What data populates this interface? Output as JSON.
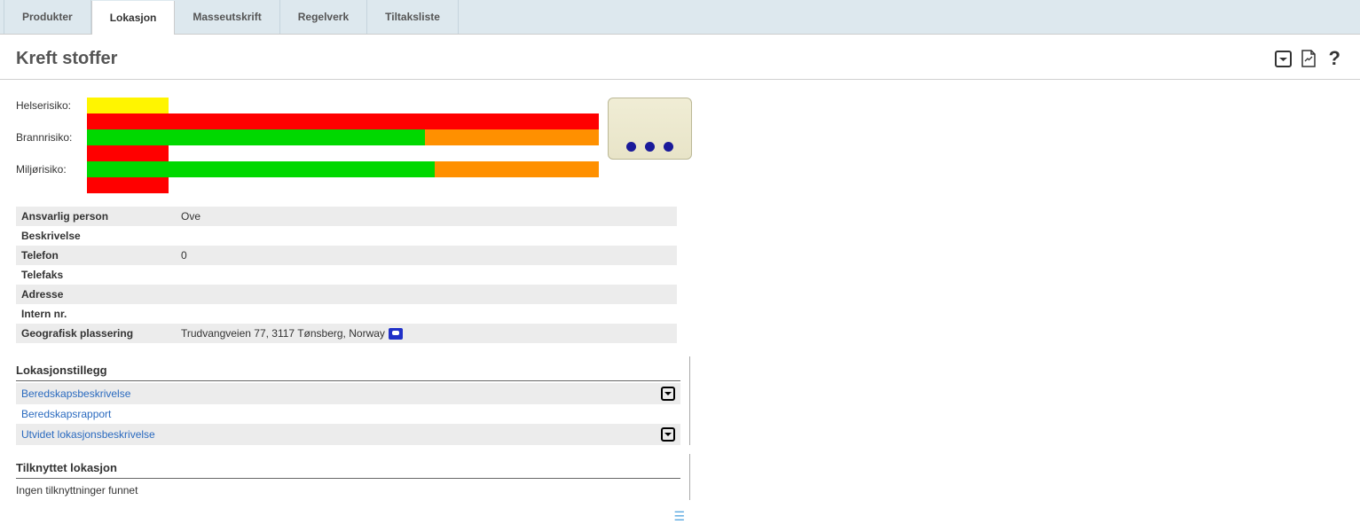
{
  "tabs": {
    "items": [
      {
        "label": "Produkter",
        "active": false
      },
      {
        "label": "Lokasjon",
        "active": true
      },
      {
        "label": "Masseutskrift",
        "active": false
      },
      {
        "label": "Regelverk",
        "active": false
      },
      {
        "label": "Tiltaksliste",
        "active": false
      }
    ]
  },
  "page_title": "Kreft stoffer",
  "risk": {
    "rows": [
      {
        "label": "Helserisiko:"
      },
      {
        "label": "Brannrisiko:"
      },
      {
        "label": "Miljørisiko:"
      }
    ]
  },
  "chart_data": {
    "type": "bar",
    "title": "",
    "xlabel": "",
    "ylabel": "",
    "categories": [
      "Helserisiko",
      "Brannrisiko",
      "Miljørisiko"
    ],
    "series": [
      {
        "name": "row1",
        "segments_pct": [
          [
            16,
            "yellow"
          ]
        ]
      },
      {
        "name": "row2",
        "segments_pct": [
          [
            100,
            "red"
          ]
        ]
      },
      {
        "name": "row3",
        "segments_pct": [
          [
            66,
            "green"
          ],
          [
            34,
            "orange"
          ]
        ]
      },
      {
        "name": "row4",
        "segments_pct": [
          [
            16,
            "red"
          ]
        ]
      },
      {
        "name": "row5",
        "segments_pct": [
          [
            68,
            "green"
          ],
          [
            32,
            "orange"
          ]
        ]
      },
      {
        "name": "row6",
        "segments_pct": [
          [
            16,
            "red"
          ]
        ]
      }
    ]
  },
  "info": {
    "rows": [
      {
        "label": "Ansvarlig person",
        "value": "Ove"
      },
      {
        "label": "Beskrivelse",
        "value": ""
      },
      {
        "label": "Telefon",
        "value": "0"
      },
      {
        "label": "Telefaks",
        "value": ""
      },
      {
        "label": "Adresse",
        "value": ""
      },
      {
        "label": "Intern nr.",
        "value": ""
      },
      {
        "label": "Geografisk plassering",
        "value": "Trudvangveien 77, 3117 Tønsberg, Norway",
        "map": true
      }
    ]
  },
  "addons": {
    "title": "Lokasjonstillegg",
    "items": [
      {
        "label": "Beredskapsbeskrivelse",
        "icon": true
      },
      {
        "label": "Beredskapsrapport",
        "icon": false
      },
      {
        "label": "Utvidet lokasjonsbeskrivelse",
        "icon": true
      }
    ]
  },
  "linked": {
    "title": "Tilknyttet lokasjon",
    "text": "Ingen tilknyttninger funnet"
  }
}
